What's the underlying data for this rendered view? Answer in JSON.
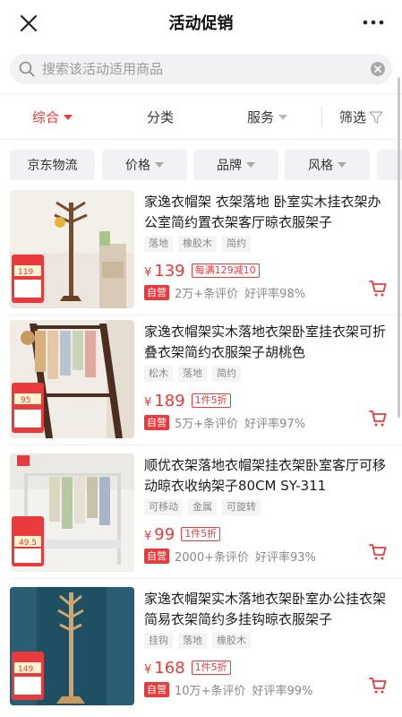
{
  "nav": {
    "title": "活动促销",
    "close_icon": "close-icon",
    "more_icon": "more-icon"
  },
  "search": {
    "placeholder": "搜索该活动适用商品"
  },
  "sort": {
    "items": [
      "综合",
      "分类",
      "服务",
      "筛选"
    ],
    "active": "综合"
  },
  "chips": [
    "京东物流",
    "价格",
    "品牌",
    "风格"
  ],
  "accent": "#e93b3d",
  "products": [
    {
      "name": "家逸衣帽架 衣架落地 卧室实木挂衣架办公室简约置衣架客厅晾衣服架子",
      "tags": [
        "落地",
        "橡胶木",
        "简约"
      ],
      "price": "139",
      "promo": "每满129减10",
      "self": "自营",
      "reviews": "2万+条评价",
      "good": "好评率98%"
    },
    {
      "name": "家逸衣帽架实木落地衣架卧室挂衣架可折叠衣架简约衣服架子胡桃色",
      "tags": [
        "松木",
        "落地",
        "简约"
      ],
      "price": "189",
      "promo": "1件5折",
      "self": "自营",
      "reviews": "5万+条评价",
      "good": "好评率97%"
    },
    {
      "name": "顺优衣架落地衣帽架挂衣架卧室客厅可移动晾衣收纳架子80CM SY-311",
      "tags": [
        "可移动",
        "金属",
        "可旋转"
      ],
      "price": "99",
      "promo": "1件5折",
      "self": "自营",
      "reviews": "2000+条评价",
      "good": "好评率93%"
    },
    {
      "name": "家逸衣帽架实木落地衣架卧室办公挂衣架简易衣架简约多挂钩晾衣服架子",
      "tags": [
        "挂钩",
        "落地",
        "橡胶木"
      ],
      "price": "168",
      "promo": "1件5折",
      "self": "自营",
      "reviews": "10万+条评价",
      "good": "好评率99%"
    }
  ]
}
